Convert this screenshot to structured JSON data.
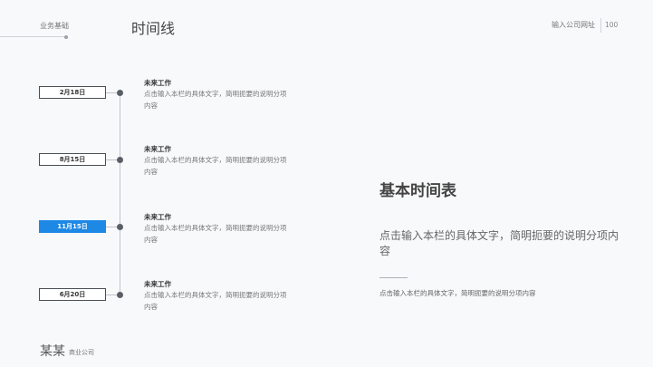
{
  "header": {
    "section": "业务基础",
    "title": "时间线",
    "company_url": "输入公司网址",
    "page_number": "100"
  },
  "timeline": {
    "items": [
      {
        "date": "2月18日",
        "title": "未来工作",
        "desc": "点击输入本栏的具体文字，简明扼要的说明分项内容",
        "active": false
      },
      {
        "date": "8月15日",
        "title": "未来工作",
        "desc": "点击输入本栏的具体文字，简明扼要的说明分项内容",
        "active": false
      },
      {
        "date": "11月15日",
        "title": "未来工作",
        "desc": "点击输入本栏的具体文字，简明扼要的说明分项内容",
        "active": true
      },
      {
        "date": "6月20日",
        "title": "未来工作",
        "desc": "点击输入本栏的具体文字，简明扼要的说明分项内容",
        "active": false
      }
    ]
  },
  "summary": {
    "heading": "基本时间表",
    "desc": "点击输入本栏的具体文字，简明扼要的说明分项内容",
    "sub_desc": "点击输入本栏的具体文字，简明扼要的说明分项内容"
  },
  "footer": {
    "name": "某某",
    "company": "商业公司"
  },
  "colors": {
    "accent": "#1e88e5",
    "background": "#f8f9fb"
  }
}
